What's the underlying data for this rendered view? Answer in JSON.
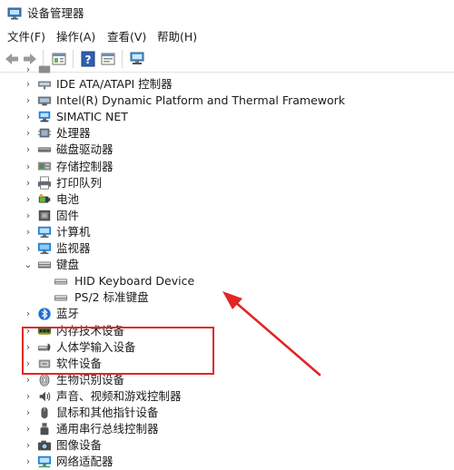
{
  "window": {
    "title": "设备管理器",
    "icon": "device-manager-icon"
  },
  "menu": [
    "文件(F)",
    "操作(A)",
    "查看(V)",
    "帮助(H)"
  ],
  "toolbar": [
    "back-icon",
    "forward-icon",
    "properties-icon",
    "help-icon",
    "update-driver-icon",
    "scan-hardware-icon"
  ],
  "tree": {
    "partial_top_label": "",
    "categories": [
      {
        "label": "IDE ATA/ATAPI 控制器",
        "icon": "ide-controller-icon",
        "expanded": false
      },
      {
        "label": "Intel(R) Dynamic Platform and Thermal Framework",
        "icon": "thermal-framework-icon",
        "expanded": false
      },
      {
        "label": "SIMATIC NET",
        "icon": "simatic-net-icon",
        "expanded": false
      },
      {
        "label": "处理器",
        "icon": "processor-icon",
        "expanded": false
      },
      {
        "label": "磁盘驱动器",
        "icon": "disk-drive-icon",
        "expanded": false
      },
      {
        "label": "存储控制器",
        "icon": "storage-controller-icon",
        "expanded": false
      },
      {
        "label": "打印队列",
        "icon": "print-queue-icon",
        "expanded": false
      },
      {
        "label": "电池",
        "icon": "battery-icon",
        "expanded": false
      },
      {
        "label": "固件",
        "icon": "firmware-icon",
        "expanded": false
      },
      {
        "label": "计算机",
        "icon": "computer-icon",
        "expanded": false
      },
      {
        "label": "监视器",
        "icon": "monitor-icon",
        "expanded": false
      },
      {
        "label": "键盘",
        "icon": "keyboard-icon",
        "expanded": true,
        "children": [
          {
            "label": "HID Keyboard Device",
            "icon": "keyboard-device-icon"
          },
          {
            "label": "PS/2 标准键盘",
            "icon": "keyboard-device-icon"
          }
        ]
      },
      {
        "label": "蓝牙",
        "icon": "bluetooth-icon",
        "expanded": false
      },
      {
        "label": "内存技术设备",
        "icon": "memory-device-icon",
        "expanded": false
      },
      {
        "label": "人体学输入设备",
        "icon": "hid-icon",
        "expanded": false
      },
      {
        "label": "软件设备",
        "icon": "software-device-icon",
        "expanded": false
      },
      {
        "label": "生物识别设备",
        "icon": "biometric-icon",
        "expanded": false
      },
      {
        "label": "声音、视频和游戏控制器",
        "icon": "audio-icon",
        "expanded": false
      },
      {
        "label": "鼠标和其他指针设备",
        "icon": "mouse-icon",
        "expanded": false
      },
      {
        "label": "通用串行总线控制器",
        "icon": "usb-icon",
        "expanded": false
      },
      {
        "label": "图像设备",
        "icon": "imaging-device-icon",
        "expanded": false
      },
      {
        "label": "网络适配器",
        "icon": "network-adapter-icon",
        "expanded": false
      }
    ]
  },
  "colors": {
    "annotation": "#e22525",
    "tree_arrow": "#555555",
    "window_background": "#ffffff"
  }
}
